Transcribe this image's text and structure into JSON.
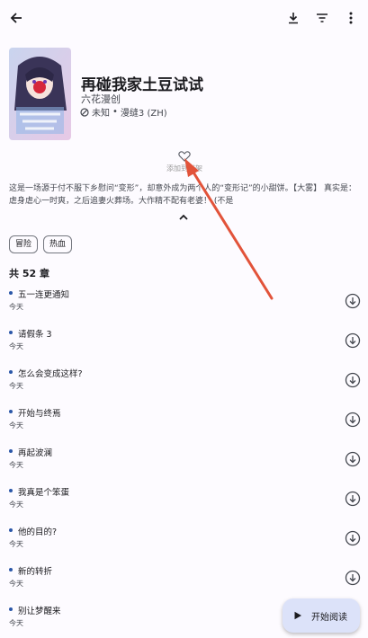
{
  "manga": {
    "title": "再碰我家土豆试试",
    "author": "六花漫创",
    "status": "未知",
    "source": "漫缝3 (ZH)",
    "status_separator": "•",
    "favorite_label": "添加到书架",
    "description": "这是一场源于付不服下乡慰问“变形”，却意外成为两个人的“变形记”的小甜饼。【大雾】 真实是：虐身虐心一时爽，之后追妻火葬场。大作精不配有老婆！ (不是",
    "tags": [
      "冒险",
      "热血"
    ],
    "chapter_count_label": "共 52 章"
  },
  "chapters": [
    {
      "name": "五一连更通知",
      "date": "今天"
    },
    {
      "name": "请假条 3",
      "date": "今天"
    },
    {
      "name": "怎么会变成这样?",
      "date": "今天"
    },
    {
      "name": "开始与终焉",
      "date": "今天"
    },
    {
      "name": "再起波澜",
      "date": "今天"
    },
    {
      "name": "我真是个笨蛋",
      "date": "今天"
    },
    {
      "name": "他的目的?",
      "date": "今天"
    },
    {
      "name": "新的转折",
      "date": "今天"
    },
    {
      "name": "别让梦醒来",
      "date": "今天"
    }
  ],
  "fab": {
    "label": "开始阅读"
  },
  "icons": {
    "back": "arrow-back-icon",
    "download": "download-icon",
    "filter": "filter-icon",
    "more": "more-vert-icon",
    "favorite": "heart-outline-icon",
    "status": "block-icon",
    "expand": "chevron-up-icon",
    "chapter_download": "download-circle-icon",
    "play": "play-icon"
  },
  "colors": {
    "accent": "#2b57a8",
    "annotation_arrow": "#e2533a",
    "fab_bg": "#dce2f9"
  }
}
